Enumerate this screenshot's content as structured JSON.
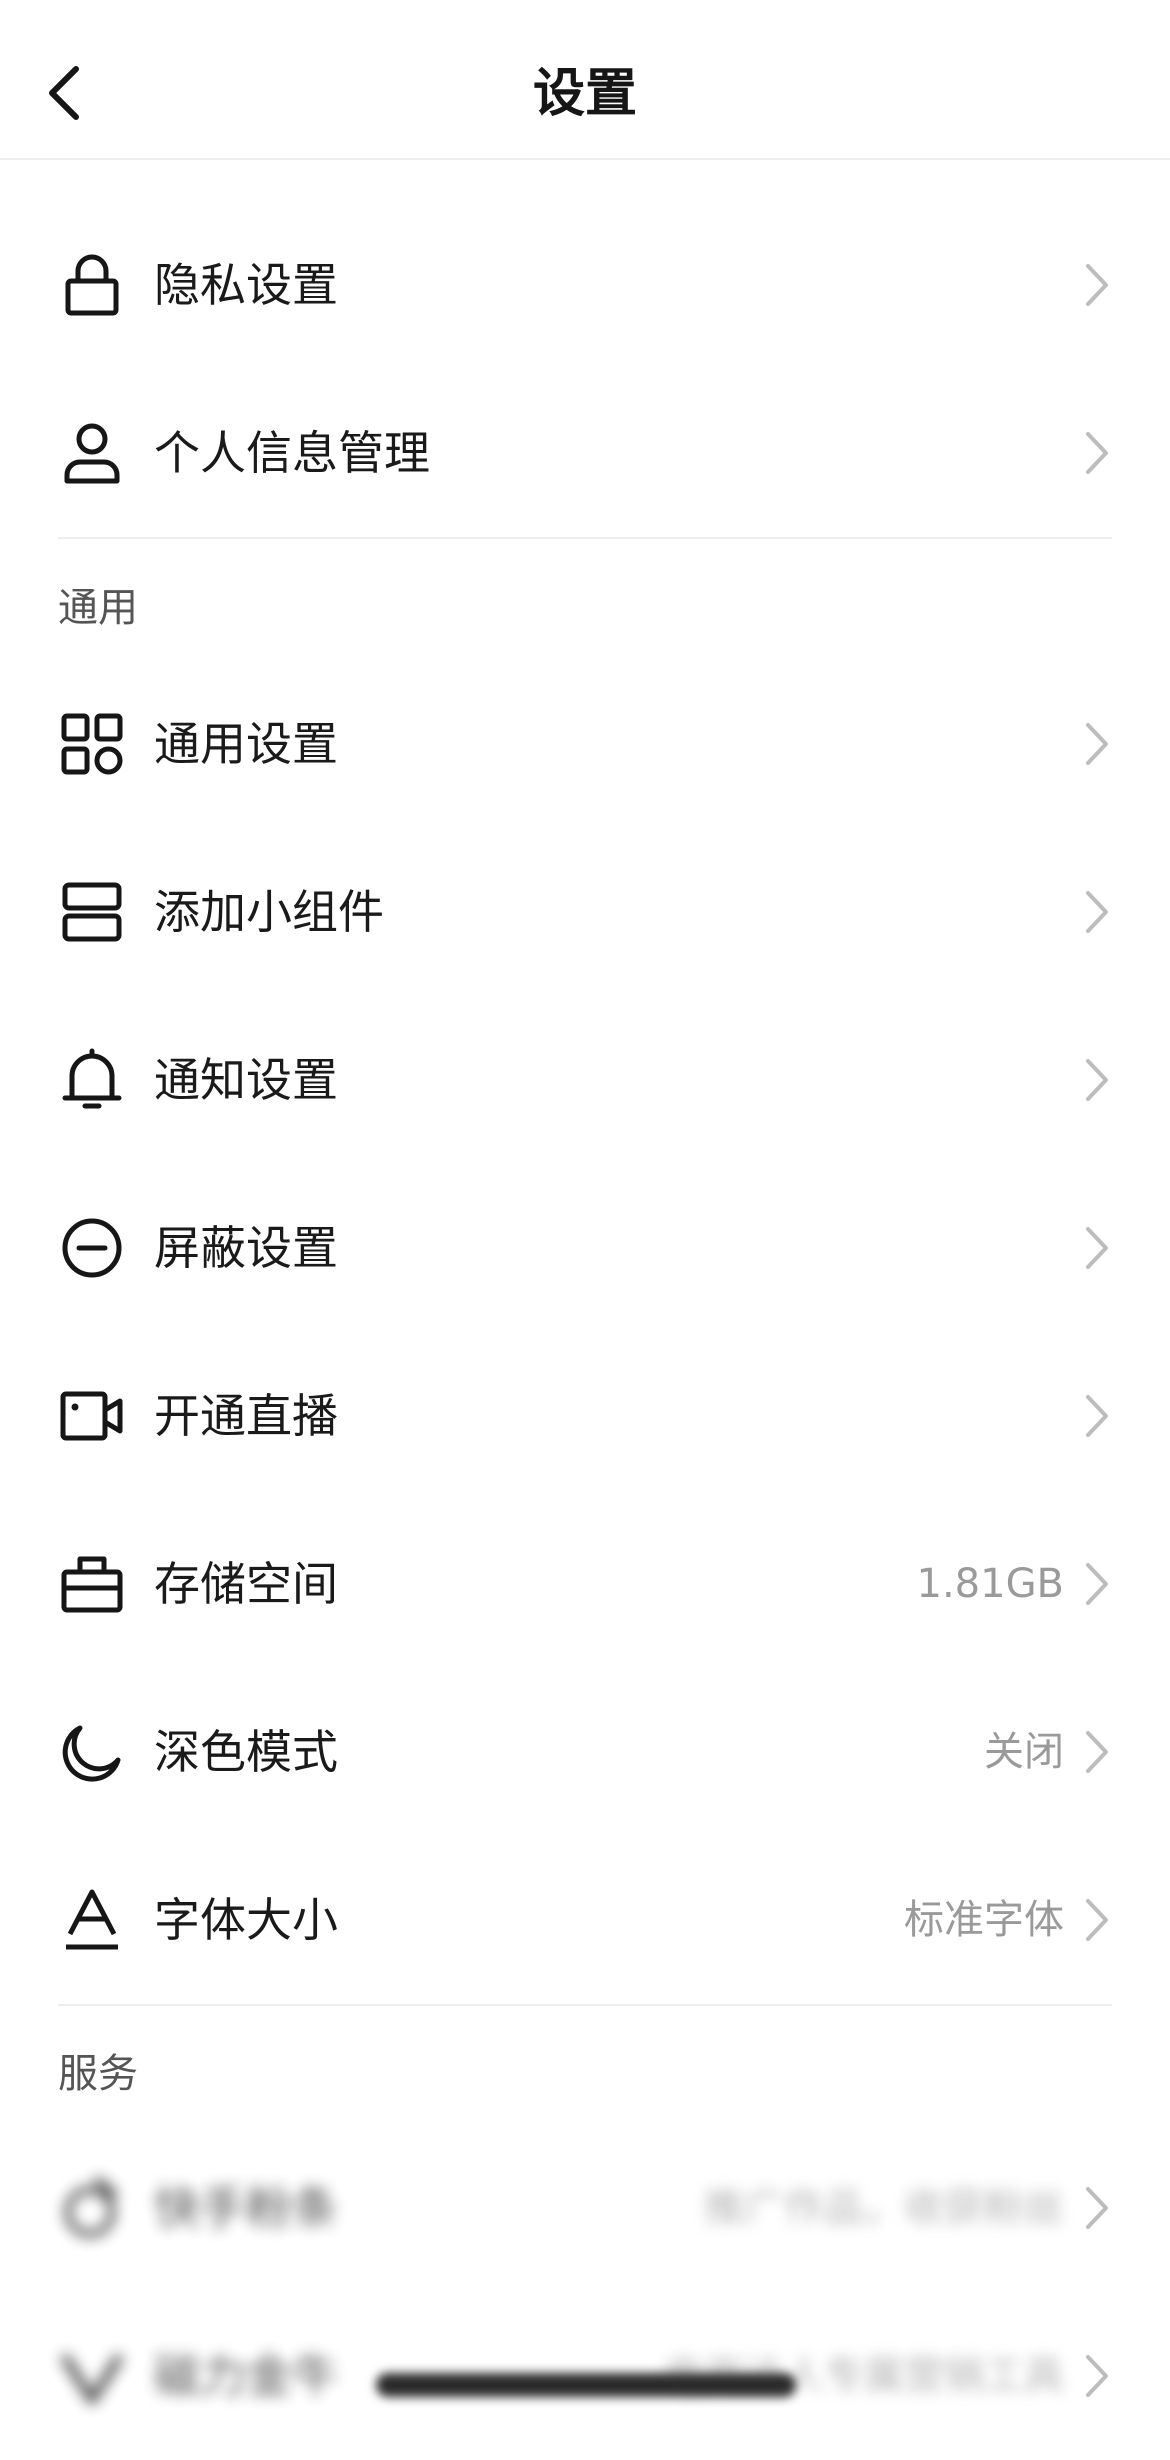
{
  "header": {
    "title": "设置",
    "back_icon": "chevron-left-icon"
  },
  "account": {
    "items": [
      {
        "label": "隐私设置",
        "icon": "lock-icon"
      },
      {
        "label": "个人信息管理",
        "icon": "user-icon"
      }
    ]
  },
  "general": {
    "title": "通用",
    "items": [
      {
        "label": "通用设置",
        "icon": "grid-icon",
        "value": ""
      },
      {
        "label": "添加小组件",
        "icon": "widget-icon",
        "value": ""
      },
      {
        "label": "通知设置",
        "icon": "bell-icon",
        "value": ""
      },
      {
        "label": "屏蔽设置",
        "icon": "block-icon",
        "value": ""
      },
      {
        "label": "开通直播",
        "icon": "video-icon",
        "value": ""
      },
      {
        "label": "存储空间",
        "icon": "storage-icon",
        "value": "1.81GB"
      },
      {
        "label": "深色模式",
        "icon": "moon-icon",
        "value": "关闭"
      },
      {
        "label": "字体大小",
        "icon": "font-size-icon",
        "value": "标准字体"
      }
    ]
  },
  "services": {
    "title": "服务",
    "items": [
      {
        "label": "快手粉条",
        "icon": "service-icon",
        "value": "推广作品，收获粉丝"
      },
      {
        "label": "磁力金牛",
        "icon": "service-v-icon",
        "value": "电商达人专属营销工具"
      }
    ]
  },
  "colors": {
    "text": "#1a1a1a",
    "secondary_text": "#9a9a9a",
    "divider": "#eeeeee",
    "chevron": "#bdbdbd"
  }
}
